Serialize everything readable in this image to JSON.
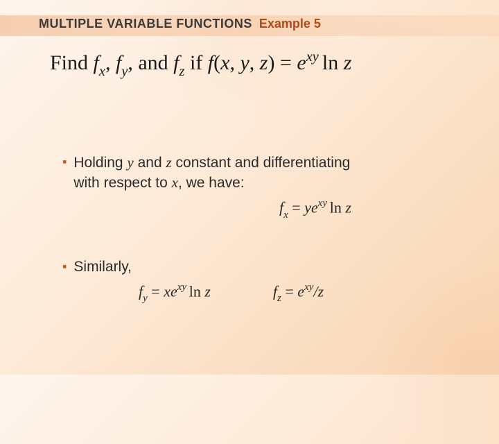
{
  "header": {
    "section_title": "MULTIPLE VARIABLE FUNCTIONS",
    "example_label": "Example 5"
  },
  "problem": {
    "lead": "Find ",
    "term1_base": "f",
    "term1_sub": "x",
    "sep1": ", ",
    "term2_base": "f",
    "term2_sub": "y",
    "sep2": ", and ",
    "term3_base": "f",
    "term3_sub": "z",
    "mid": " if ",
    "func_base": "f",
    "func_args_open": "(",
    "arg1": "x",
    "argsep1": ", ",
    "arg2": "y",
    "argsep2": ", ",
    "arg3": "z",
    "func_args_close": ") = ",
    "rhs_e": "e",
    "rhs_exp": "xy ",
    "rhs_ln": "ln ",
    "rhs_z": "z"
  },
  "bullets": {
    "b1": {
      "line1_pre": "Holding ",
      "y": "y",
      "line1_mid": " and ",
      "z": "z",
      "line1_post": " constant and differentiating",
      "line2_pre": "with respect to ",
      "x": "x",
      "line2_post": ", we have:",
      "formula_lhs_base": "f",
      "formula_lhs_sub": "x",
      "formula_eq": " = ",
      "formula_y": "y",
      "formula_e": "e",
      "formula_exp": "xy ",
      "formula_ln": "ln ",
      "formula_z": "z"
    },
    "b2": {
      "text": "Similarly,",
      "fy_lhs_base": "f",
      "fy_lhs_sub": "y",
      "fy_eq": " = ",
      "fy_x": "x",
      "fy_e": "e",
      "fy_exp": "xy ",
      "fy_ln": "ln ",
      "fy_z": "z",
      "fz_lhs_base": "f",
      "fz_lhs_sub": "z",
      "fz_eq": " = ",
      "fz_e": "e",
      "fz_exp": "xy",
      "fz_slash": "/",
      "fz_z": "z"
    }
  }
}
